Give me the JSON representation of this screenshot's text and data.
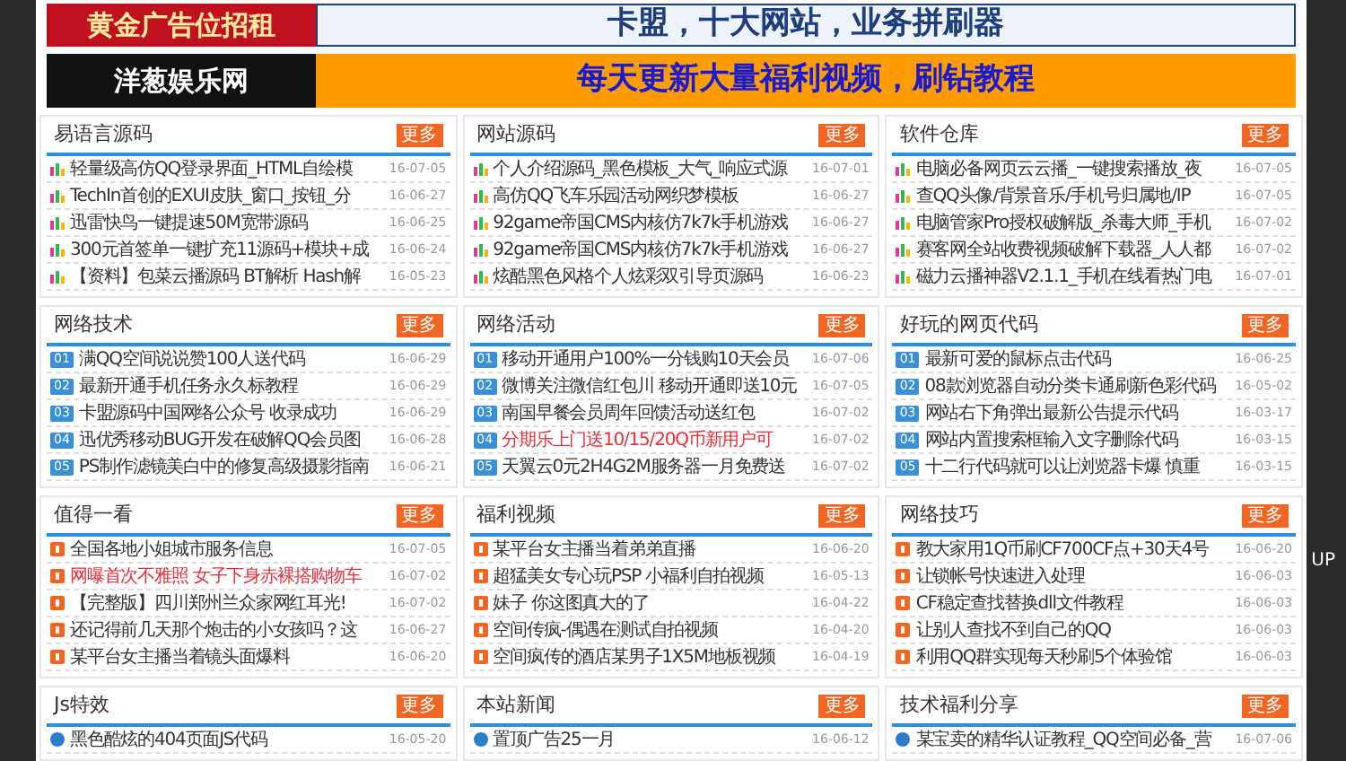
{
  "banners": [
    {
      "kind": "gold",
      "left": "黄金广告位招租",
      "right": "卡盟，十大网站，业务拼刷器"
    },
    {
      "kind": "orange",
      "left": "洋葱娱乐网",
      "right": "每天更新大量福利视频，刷钻教程"
    }
  ],
  "sections": [
    {
      "title": "易语言源码",
      "more": "更多",
      "items": [
        {
          "kind": "bars",
          "text": "轻量级高仿QQ登录界面_HTML自绘模",
          "date": "16-07-05",
          "highlight": false
        },
        {
          "kind": "bars",
          "text": "TechIn首创的EXUI皮肤_窗口_按钮_分",
          "date": "16-06-27",
          "highlight": false
        },
        {
          "kind": "bars",
          "text": "迅雷快鸟一键提速50M宽带源码",
          "date": "16-06-25",
          "highlight": false
        },
        {
          "kind": "bars",
          "text": "300元首签单一键扩充11源码+模块+成",
          "date": "16-06-24",
          "highlight": false
        },
        {
          "kind": "bars",
          "text": "【资料】包菜云播源码 BT解析 Hash解",
          "date": "16-05-23",
          "highlight": false
        }
      ]
    },
    {
      "title": "网站源码",
      "more": "更多",
      "items": [
        {
          "kind": "bars",
          "text": "个人介绍源码_黑色模板_大气_响应式源",
          "date": "16-07-01",
          "highlight": false
        },
        {
          "kind": "bars",
          "text": "高仿QQ飞车乐园活动网织梦模板",
          "date": "16-06-27",
          "highlight": false
        },
        {
          "kind": "bars",
          "text": "92game帝国CMS内核仿7k7k手机游戏",
          "date": "16-06-27",
          "highlight": false
        },
        {
          "kind": "bars",
          "text": "92game帝国CMS内核仿7k7k手机游戏",
          "date": "16-06-27",
          "highlight": false
        },
        {
          "kind": "bars",
          "text": "炫酷黑色风格个人炫彩双引导页源码",
          "date": "16-06-23",
          "highlight": false
        }
      ]
    },
    {
      "title": "软件仓库",
      "more": "更多",
      "items": [
        {
          "kind": "bars",
          "text": "电脑必备网页云云播_一键搜索播放_夜",
          "date": "16-07-05",
          "highlight": false
        },
        {
          "kind": "bars",
          "text": "查QQ头像/背景音乐/手机号归属地/IP",
          "date": "16-07-05",
          "highlight": false
        },
        {
          "kind": "bars",
          "text": "电脑管家Pro授权破解版_杀毒大师_手机",
          "date": "16-07-02",
          "highlight": false
        },
        {
          "kind": "bars",
          "text": "赛客网全站收费视频破解下载器_人人都",
          "date": "16-07-02",
          "highlight": false
        },
        {
          "kind": "bars",
          "text": "磁力云播神器V2.1.1_手机在线看热门电",
          "date": "16-07-01",
          "highlight": false
        }
      ]
    },
    {
      "title": "网络技术",
      "more": "更多",
      "items": [
        {
          "kind": "number",
          "no": "01",
          "text": "满QQ空间说说赞100人送代码",
          "date": "16-06-29",
          "highlight": false
        },
        {
          "kind": "number",
          "no": "02",
          "text": "最新开通手机任务永久标教程",
          "date": "16-06-29",
          "highlight": false
        },
        {
          "kind": "number",
          "no": "03",
          "text": "卡盟源码中国网络公众号 收录成功",
          "date": "16-06-29",
          "highlight": false
        },
        {
          "kind": "number",
          "no": "04",
          "text": "迅优秀移动BUG开发在破解QQ会员图",
          "date": "16-06-28",
          "highlight": false
        },
        {
          "kind": "number",
          "no": "05",
          "text": "PS制作滤镜美白中的修复高级摄影指南",
          "date": "16-06-21",
          "highlight": false
        }
      ]
    },
    {
      "title": "网络活动",
      "more": "更多",
      "items": [
        {
          "kind": "number",
          "no": "01",
          "text": "移动开通用户100%一分钱购10天会员",
          "date": "16-07-06",
          "highlight": false
        },
        {
          "kind": "number",
          "no": "02",
          "text": "微博关注微信红包川 移动开通即送10元",
          "date": "16-07-05",
          "highlight": false
        },
        {
          "kind": "number",
          "no": "03",
          "text": "南国早餐会员周年回馈活动送红包",
          "date": "16-07-02",
          "highlight": false
        },
        {
          "kind": "number",
          "no": "04",
          "text": "分期乐上门送10/15/20Q币新用户可",
          "date": "16-07-02",
          "highlight": true
        },
        {
          "kind": "number",
          "no": "05",
          "text": "天翼云0元2H4G2M服务器一月免费送",
          "date": "16-07-02",
          "highlight": false
        }
      ]
    },
    {
      "title": "好玩的网页代码",
      "more": "更多",
      "items": [
        {
          "kind": "number",
          "no": "01",
          "text": "最新可爱的鼠标点击代码",
          "date": "16-06-25",
          "highlight": false
        },
        {
          "kind": "number",
          "no": "02",
          "text": "08款浏览器自动分类卡通刷新色彩代码",
          "date": "16-05-02",
          "highlight": false
        },
        {
          "kind": "number",
          "no": "03",
          "text": "网站右下角弹出最新公告提示代码",
          "date": "16-03-17",
          "highlight": false
        },
        {
          "kind": "number",
          "no": "04",
          "text": "网站内置搜索框输入文字删除代码",
          "date": "16-03-15",
          "highlight": false
        },
        {
          "kind": "number",
          "no": "05",
          "text": "十二行代码就可以让浏览器卡爆 慎重",
          "date": "16-03-15",
          "highlight": false
        }
      ]
    },
    {
      "title": "值得一看",
      "more": "更多",
      "items": [
        {
          "kind": "square",
          "text": "全国各地小姐城市服务信息",
          "date": "16-07-05",
          "highlight": false
        },
        {
          "kind": "square",
          "text": "网曝首次不雅照 女子下身赤裸搭购物车",
          "date": "16-07-02",
          "highlight": true
        },
        {
          "kind": "square",
          "text": "【完整版】四川郑州兰众家网红耳光!",
          "date": "16-07-02",
          "highlight": false
        },
        {
          "kind": "square",
          "text": "还记得前几天那个炮击的小女孩吗？这",
          "date": "16-06-27",
          "highlight": false
        },
        {
          "kind": "square",
          "text": "某平台女主播当着镜头面爆料",
          "date": "16-06-20",
          "highlight": false
        }
      ]
    },
    {
      "title": "福利视频",
      "more": "更多",
      "items": [
        {
          "kind": "square",
          "text": "某平台女主播当着弟弟直播",
          "date": "16-06-20",
          "highlight": false
        },
        {
          "kind": "square",
          "text": "超猛美女专心玩PSP 小福利自拍视频",
          "date": "16-05-13",
          "highlight": false
        },
        {
          "kind": "square",
          "text": "妹子 你这图真大的了",
          "date": "16-04-22",
          "highlight": false
        },
        {
          "kind": "square",
          "text": "空间传疯-偶遇在测试自拍视频",
          "date": "16-04-20",
          "highlight": false
        },
        {
          "kind": "square",
          "text": "空间疯传的酒店某男子1X5M地板视频",
          "date": "16-04-19",
          "highlight": false
        }
      ]
    },
    {
      "title": "网络技巧",
      "more": "更多",
      "items": [
        {
          "kind": "square",
          "text": "教大家用1Q币刷CF700CF点+30天4号",
          "date": "16-06-20",
          "highlight": false
        },
        {
          "kind": "square",
          "text": "让锁帐号快速进入处理",
          "date": "16-06-03",
          "highlight": false
        },
        {
          "kind": "square",
          "text": "CF稳定查找替换dll文件教程",
          "date": "16-06-03",
          "highlight": false
        },
        {
          "kind": "square",
          "text": "让别人查找不到自己的QQ",
          "date": "16-06-03",
          "highlight": false
        },
        {
          "kind": "square",
          "text": "利用QQ群实现每天秒刷5个体验馆",
          "date": "16-06-03",
          "highlight": false
        }
      ]
    },
    {
      "title": "Js特效",
      "more": "更多",
      "items": [
        {
          "kind": "bullet",
          "text": "黑色酷炫的404页面JS代码",
          "date": "16-05-20",
          "highlight": false
        }
      ]
    },
    {
      "title": "本站新闻",
      "more": "更多",
      "items": [
        {
          "kind": "bullet",
          "text": "置顶广告25一月",
          "date": "16-06-12",
          "highlight": false
        }
      ]
    },
    {
      "title": "技术福利分享",
      "more": "更多",
      "items": [
        {
          "kind": "bullet",
          "text": "某宝卖的精华认证教程_QQ空间必备_营",
          "date": "16-07-06",
          "highlight": false
        }
      ]
    }
  ],
  "up_button": "UP"
}
